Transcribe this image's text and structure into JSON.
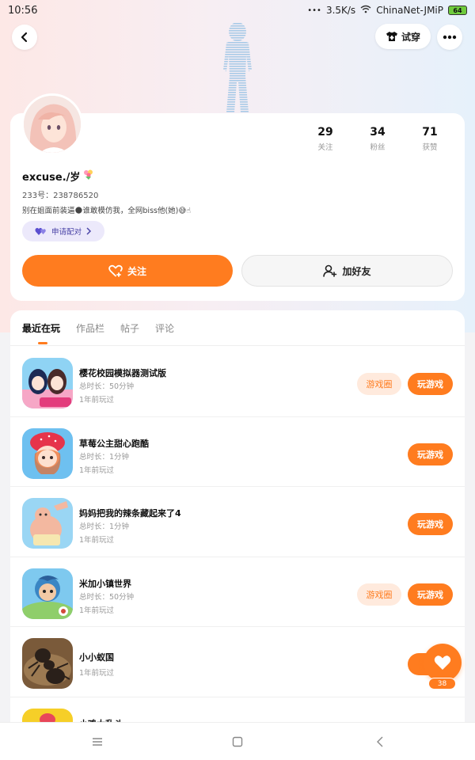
{
  "status_bar": {
    "time": "10:56",
    "speed": "3.5K/s",
    "network": "ChinaNet-JMiP",
    "battery": "64"
  },
  "top_nav": {
    "try_on_label": "试穿"
  },
  "profile": {
    "username": "excuse./岁",
    "user_id": "233号：238786520",
    "bio": "别在姐面前装逼🌑谁敢模仿我，全网biss他(她)😅☝",
    "pair_label": "申请配对",
    "stats": [
      {
        "num": "29",
        "label": "关注"
      },
      {
        "num": "34",
        "label": "粉丝"
      },
      {
        "num": "71",
        "label": "获赞"
      }
    ],
    "follow_label": "关注",
    "add_friend_label": "加好友"
  },
  "tabs": [
    "最近在玩",
    "作品栏",
    "帖子",
    "评论"
  ],
  "games": [
    {
      "name": "樱花校园模拟器测试版",
      "duration": "总时长：50分钟",
      "last_played": "1年前玩过",
      "has_circle": true,
      "circle_label": "游戏圈",
      "play_label": "玩游戏"
    },
    {
      "name": "草莓公主甜心跑酷",
      "duration": "总时长：1分钟",
      "last_played": "1年前玩过",
      "has_circle": false,
      "circle_label": "",
      "play_label": "玩游戏"
    },
    {
      "name": "妈妈把我的辣条藏起来了4",
      "duration": "总时长：1分钟",
      "last_played": "1年前玩过",
      "has_circle": false,
      "circle_label": "",
      "play_label": "玩游戏"
    },
    {
      "name": "米加小镇世界",
      "duration": "总时长：50分钟",
      "last_played": "1年前玩过",
      "has_circle": true,
      "circle_label": "游戏圈",
      "play_label": "玩游戏"
    },
    {
      "name": "小小蚁国",
      "duration": "",
      "last_played": "1年前玩过",
      "has_circle": false,
      "circle_label": "",
      "play_label": "玩"
    },
    {
      "name": "小鸡大乱斗",
      "duration": "",
      "last_played": "",
      "has_circle": false,
      "circle_label": "",
      "play_label": ""
    }
  ],
  "fab": {
    "count": "38"
  },
  "colors": {
    "accent": "#ff7c1f",
    "accent_light": "#ffeadd",
    "pair_bg": "#ece9fb"
  }
}
